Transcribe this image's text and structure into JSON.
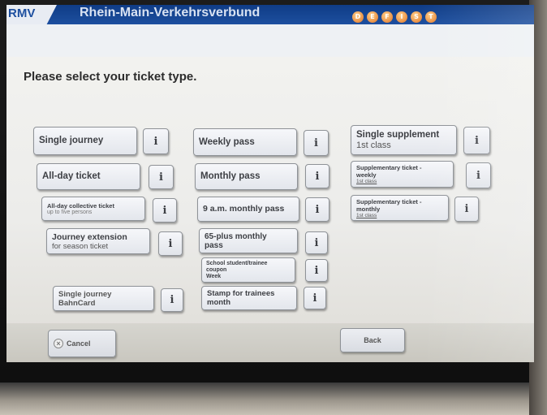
{
  "header": {
    "logo": "RMV",
    "brand": "Rhein-Main-Verkehrsverbund",
    "language_dots": [
      "D",
      "E",
      "F",
      "I",
      "S",
      "T"
    ]
  },
  "page_title": "Please select your ticket type.",
  "info_label": "i",
  "tickets": {
    "single_journey": {
      "line1": "Single journey",
      "line2": ""
    },
    "all_day_ticket": {
      "line1": "All-day ticket",
      "line2": ""
    },
    "all_day_collective": {
      "line1": "All-day collective ticket",
      "line2": "up to five persons"
    },
    "journey_extension": {
      "line1": "Journey extension",
      "line2": "for season ticket"
    },
    "single_journey_bahncard": {
      "line1": "Single journey",
      "line2": "BahnCard"
    },
    "weekly_pass": {
      "line1": "Weekly pass",
      "line2": ""
    },
    "monthly_pass": {
      "line1": "Monthly pass",
      "line2": ""
    },
    "nine_am_monthly": {
      "line1": "9 a.m. monthly pass",
      "line2": ""
    },
    "sixty_five_plus": {
      "line1": "65-plus monthly",
      "line2": "pass"
    },
    "school_student_coupon": {
      "line1": "School student/trainee",
      "line2": "coupon",
      "line3": "Week"
    },
    "stamp_trainees": {
      "line1": "Stamp for trainees",
      "line2": "month"
    },
    "single_supplement": {
      "line1": "Single supplement",
      "line2": "1st class"
    },
    "supp_weekly": {
      "line1": "Supplementary ticket -",
      "line2": "weekly",
      "line3": "1st class"
    },
    "supp_monthly": {
      "line1": "Supplementary ticket -",
      "line2": "monthly",
      "line3": "1st class"
    }
  },
  "footer": {
    "cancel_label": "Cancel",
    "cancel_icon": "cancel-x-icon",
    "back_label": "Back"
  },
  "colors": {
    "header_blue": "#1d4f9f",
    "language_orange": "#e07424",
    "button_text": "#3d3f44"
  }
}
